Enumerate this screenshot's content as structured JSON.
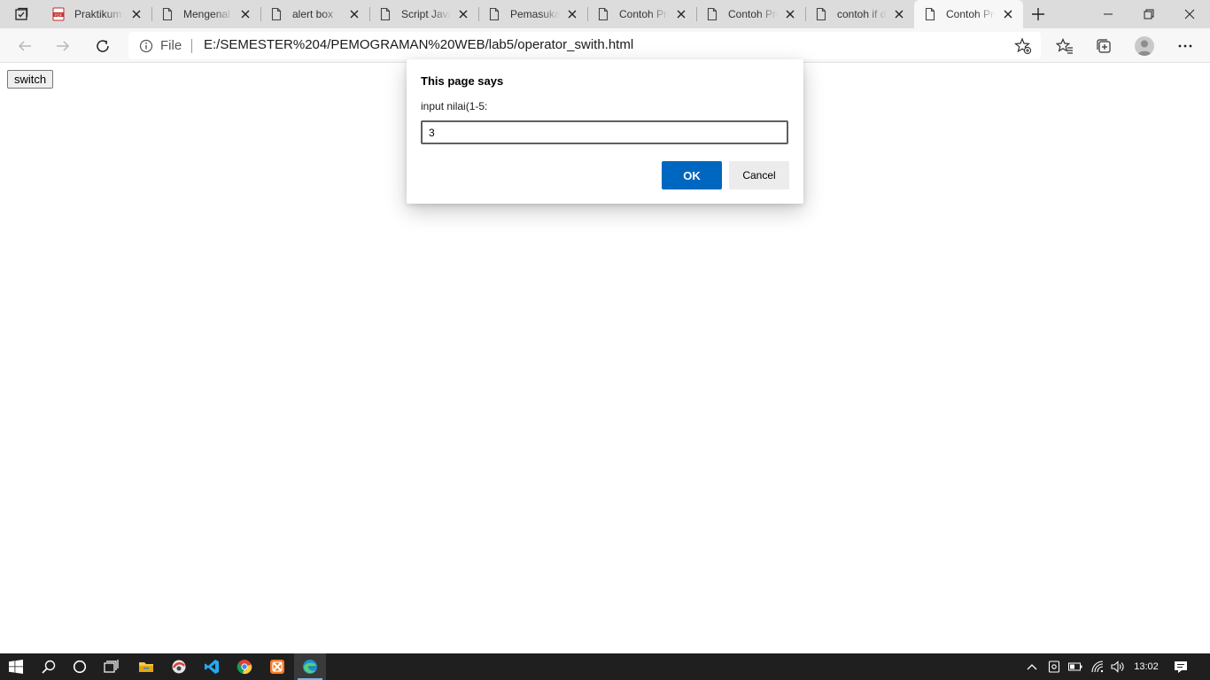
{
  "tabs": [
    {
      "title": "Praktikum",
      "icon": "pdf-icon",
      "active": false
    },
    {
      "title": "Mengenal",
      "icon": "page-icon",
      "active": false
    },
    {
      "title": "alert box",
      "icon": "page-icon",
      "active": false
    },
    {
      "title": "Script Java",
      "icon": "page-icon",
      "active": false
    },
    {
      "title": "Pemasukan",
      "icon": "page-icon",
      "active": false
    },
    {
      "title": "Contoh Pro",
      "icon": "page-icon",
      "active": false
    },
    {
      "title": "Contoh Pro",
      "icon": "page-icon",
      "active": false
    },
    {
      "title": "contoh if d",
      "icon": "page-icon",
      "active": false
    },
    {
      "title": "Contoh Pro",
      "icon": "page-icon",
      "active": true
    }
  ],
  "address": {
    "scheme": "File",
    "url": "E:/SEMESTER%204/PEMOGRAMAN%20WEB/lab5/operator_swith.html"
  },
  "page": {
    "button_label": "switch"
  },
  "dialog": {
    "title": "This page says",
    "message": "input nilai(1-5:",
    "input_value": "3",
    "ok_label": "OK",
    "cancel_label": "Cancel"
  },
  "taskbar": {
    "clock": "13:02"
  },
  "colors": {
    "accent": "#0067c0",
    "tabstrip": "#dcdcdc",
    "toolbar": "#f7f7f7",
    "taskbar": "#1f1f1f"
  }
}
